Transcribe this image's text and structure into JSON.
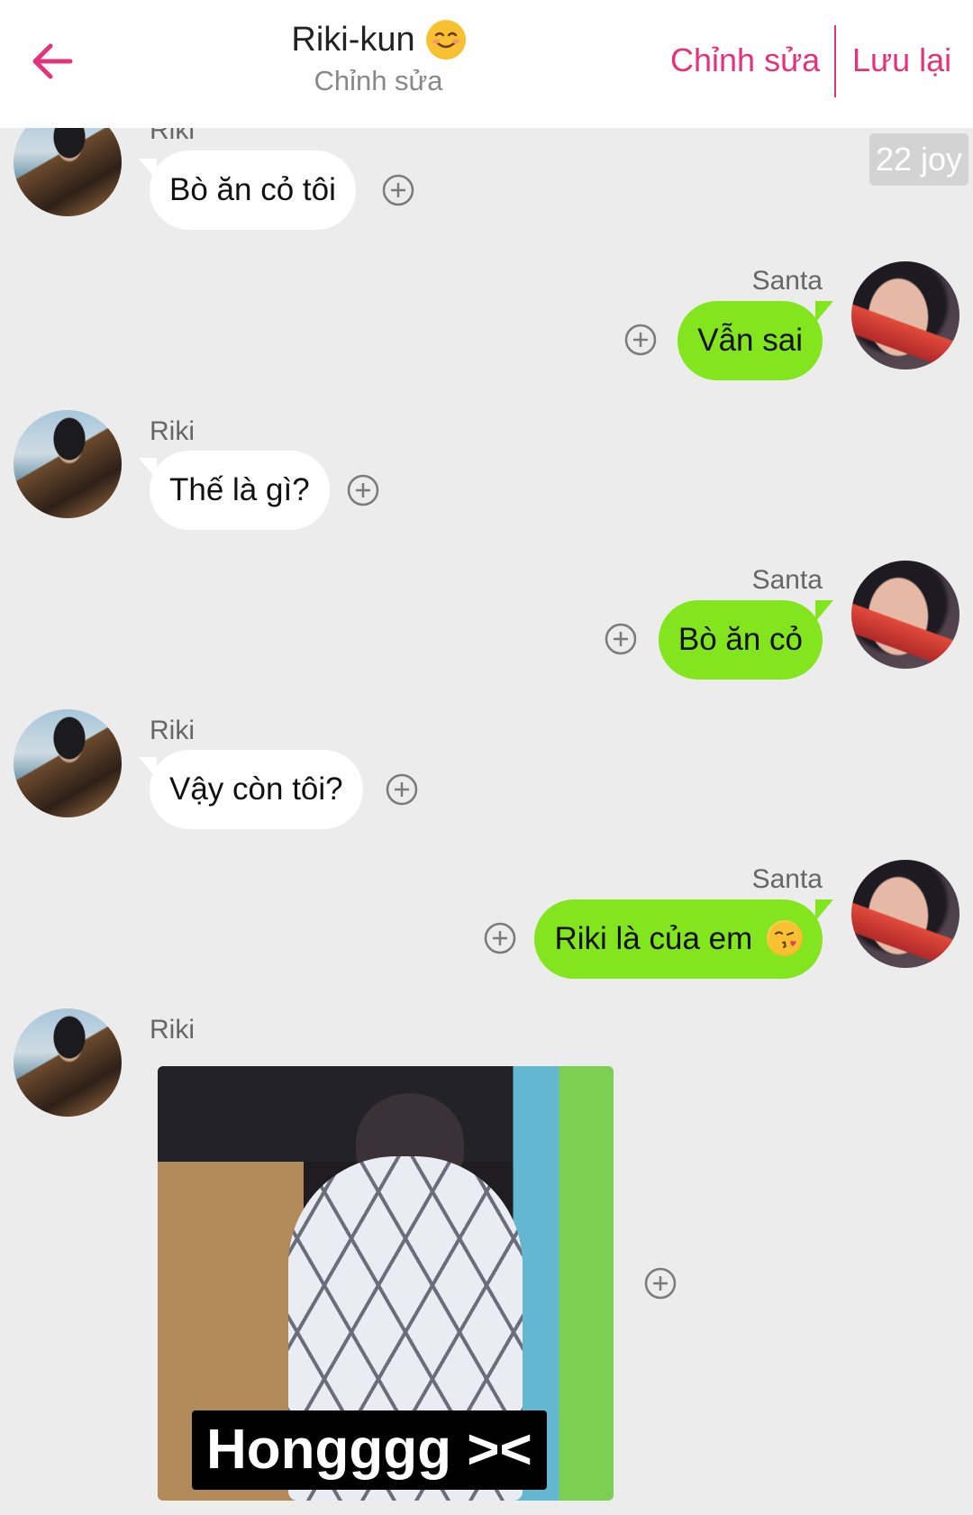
{
  "header": {
    "title": "Riki-kun",
    "title_emoji": "smiling-face-emoji",
    "subtitle": "Chỉnh sửa",
    "edit_label": "Chỉnh sửa",
    "save_label": "Lưu lại",
    "accent_color": "#e3337b"
  },
  "date_badge": "22 joy",
  "messages": [
    {
      "sender": "Riki",
      "text": "Bò ăn cỏ tôi",
      "side": "in"
    },
    {
      "sender": "Santa",
      "text": "Vẫn sai",
      "side": "out"
    },
    {
      "sender": "Riki",
      "text": "Thế là gì?",
      "side": "in"
    },
    {
      "sender": "Santa",
      "text": "Bò ăn cỏ",
      "side": "out"
    },
    {
      "sender": "Riki",
      "text": "Vậy còn tôi?",
      "side": "in"
    },
    {
      "sender": "Santa",
      "text": "Riki là của em",
      "emoji": "kissing-face-emoji",
      "side": "out"
    },
    {
      "sender": "Riki",
      "type": "image",
      "caption": "Hongggg ><",
      "side": "in"
    }
  ],
  "colors": {
    "background": "#ececec",
    "incoming_bubble": "#ffffff",
    "outgoing_bubble": "#83e51e"
  }
}
